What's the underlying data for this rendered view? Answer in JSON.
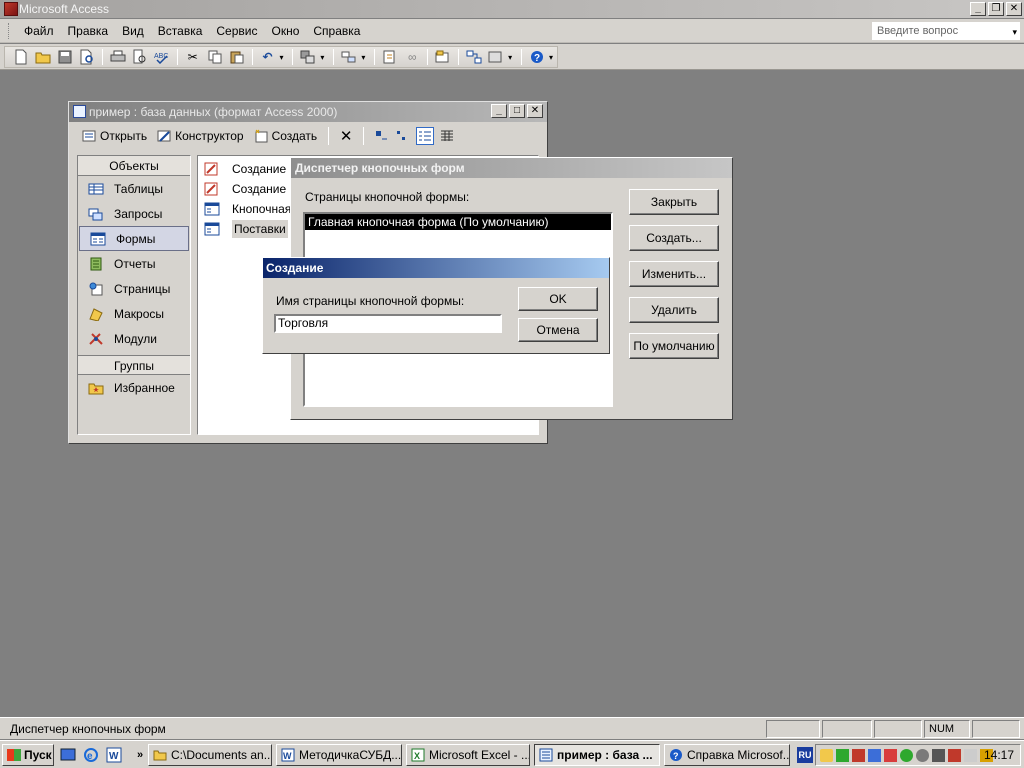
{
  "app": {
    "title": "Microsoft Access"
  },
  "menu": {
    "items": [
      "Файл",
      "Правка",
      "Вид",
      "Вставка",
      "Сервис",
      "Окно",
      "Справка"
    ],
    "question_placeholder": "Введите вопрос"
  },
  "db_window": {
    "title": "пример : база данных (формат Access 2000)",
    "toolbar": {
      "open": "Открыть",
      "design": "Конструктор",
      "create": "Создать"
    },
    "objects_header": "Объекты",
    "objects": [
      "Таблицы",
      "Запросы",
      "Формы",
      "Отчеты",
      "Страницы",
      "Макросы",
      "Модули"
    ],
    "selected_object": "Формы",
    "groups_header": "Группы",
    "groups": [
      "Избранное"
    ],
    "list_items": [
      "Создание ф",
      "Создание ф",
      "Кнопочная",
      "Поставки"
    ]
  },
  "switchboard_manager": {
    "title": "Диспетчер кнопочных форм",
    "pages_label": "Страницы кнопочной формы:",
    "pages": [
      "Главная кнопочная форма (По умолчанию)"
    ],
    "buttons": {
      "close": "Закрыть",
      "create": "Создать...",
      "edit": "Изменить...",
      "delete": "Удалить",
      "default": "По умолчанию"
    }
  },
  "create_dialog": {
    "title": "Создание",
    "name_label": "Имя страницы кнопочной формы:",
    "name_value": "Торговля",
    "ok": "OK",
    "cancel": "Отмена"
  },
  "statusbar": {
    "text": "Диспетчер кнопочных форм",
    "num": "NUM"
  },
  "taskbar": {
    "start": "Пуск",
    "tasks": [
      "C:\\Documents an...",
      "МетодичкаСУБД...",
      "Microsoft Excel - ...",
      "пример : база ...",
      "Справка Microsof..."
    ],
    "lang": "RU",
    "clock": "14:17"
  }
}
